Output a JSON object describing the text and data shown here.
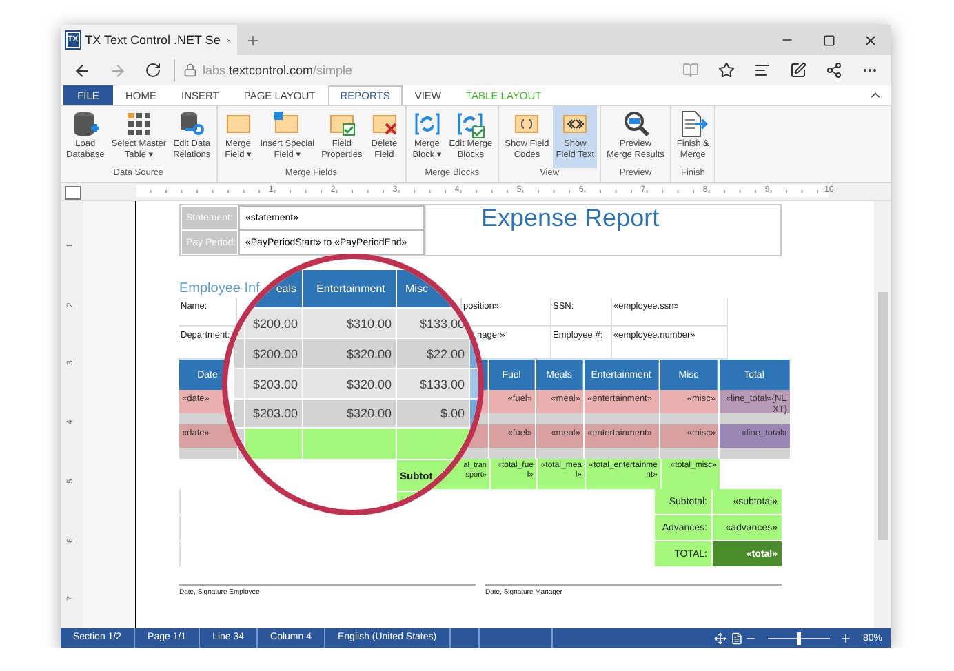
{
  "browser": {
    "tab_icon": "TX",
    "tab_title": "TX Text Control .NET Se",
    "url": {
      "prefix": "labs.",
      "domain": "textcontrol.com",
      "path": "/simple"
    }
  },
  "ribbon": {
    "tabs": [
      {
        "label": "FILE",
        "kind": "file",
        "selected": false
      },
      {
        "label": "HOME",
        "kind": "plain",
        "selected": false
      },
      {
        "label": "INSERT",
        "kind": "plain",
        "selected": false
      },
      {
        "label": "PAGE LAYOUT",
        "kind": "plain",
        "selected": false
      },
      {
        "label": "REPORTS",
        "kind": "plain",
        "selected": true
      },
      {
        "label": "VIEW",
        "kind": "plain",
        "selected": false
      },
      {
        "label": "TABLE LAYOUT",
        "kind": "contextual",
        "selected": false
      }
    ],
    "groups": [
      {
        "title": "Data Source",
        "buttons": [
          {
            "label": "Load\nDatabase",
            "kind": "database",
            "selected": false
          },
          {
            "label": "Select Master\nTable ▾",
            "kind": "grid",
            "selected": false
          },
          {
            "label": "Edit Data\nRelations",
            "kind": "relations",
            "selected": false
          }
        ]
      },
      {
        "title": "Merge Fields",
        "buttons": [
          {
            "label": "Merge\nField ▾",
            "kind": "field",
            "selected": false
          },
          {
            "label": "Insert Special\nField ▾",
            "kind": "special",
            "selected": false
          },
          {
            "label": "Field\nProperties",
            "kind": "properties",
            "selected": false
          },
          {
            "label": "Delete\nField",
            "kind": "delete",
            "selected": false
          }
        ]
      },
      {
        "title": "Merge Blocks",
        "buttons": [
          {
            "label": "Merge\nBlock ▾",
            "kind": "block",
            "selected": false
          },
          {
            "label": "Edit Merge\nBlocks",
            "kind": "editblock",
            "selected": false
          }
        ]
      },
      {
        "title": "View",
        "buttons": [
          {
            "label": "Show Field\nCodes",
            "kind": "codes",
            "selected": false
          },
          {
            "label": "Show\nField Text",
            "kind": "text",
            "selected": true
          }
        ]
      },
      {
        "title": "Preview",
        "buttons": [
          {
            "label": "Preview\nMerge Results",
            "kind": "preview",
            "selected": false
          }
        ]
      },
      {
        "title": "Finish",
        "buttons": [
          {
            "label": "Finish &\nMerge",
            "kind": "finish",
            "selected": false
          }
        ]
      }
    ]
  },
  "rulers": {
    "horizontal": [
      "1",
      "2",
      "3",
      "4",
      "5",
      "6",
      "7",
      "8",
      "9",
      "10"
    ],
    "vertical": [
      "1",
      "2",
      "3",
      "4",
      "5",
      "6",
      "7"
    ]
  },
  "document": {
    "header": {
      "rows": [
        {
          "label": "Statement:",
          "value": "«statement»"
        },
        {
          "label": "Pay Period:",
          "value": "«PayPeriodStart» to «PayPeriodEnd»"
        }
      ],
      "title": "Expense Report"
    },
    "info_heading": "Employee Inf",
    "info_rows": [
      {
        "label": "Name:",
        "value": "position»",
        "label_2": "SSN:",
        "value_2": "«employee.ssn»"
      },
      {
        "label": "Department:",
        "value": "nager»",
        "label_2": "Employee #:",
        "value_2": "«employee.number»"
      }
    ],
    "expense_columns": [
      "Date",
      "Fuel",
      "Meals",
      "Entertainment",
      "Misc",
      "Total"
    ],
    "expense_rows": [
      {
        "date": "«date»",
        "cells": [
          "«fuel»",
          "«meal»",
          "«entertainment»",
          "«misc»",
          "«line_total»{NEXT}"
        ]
      },
      {
        "date": "«date»",
        "cells": [
          "«fuel»",
          "«meal»",
          "«entertainment»",
          "«misc»",
          "«line_total»"
        ]
      }
    ],
    "totals": {
      "partial": "al_transport»",
      "cells": [
        "«total_fuel»",
        "«total_meal»",
        "«total_entertainment»",
        "«total_misc»"
      ]
    },
    "summary": [
      {
        "label": "Subtotal:",
        "value": "«subtotal»",
        "kind": "normal"
      },
      {
        "label": "Advances:",
        "value": "«advances»",
        "kind": "normal"
      },
      {
        "label": "TOTAL:",
        "value": "«total»",
        "kind": "grand"
      }
    ],
    "signatures": [
      "Date, Signature Employee",
      "Date, Signature Manager"
    ]
  },
  "magnifier": {
    "columns": [
      "eals",
      "Entertainment",
      "Misc"
    ],
    "rows": [
      [
        "$200.00",
        "$310.00",
        "$133.00"
      ],
      [
        "$200.00",
        "$320.00",
        "$22.00"
      ],
      [
        "$203.00",
        "$320.00",
        "$133.00"
      ],
      [
        "$203.00",
        "$320.00",
        "$.00"
      ]
    ],
    "subtotal_label": "Subtot"
  },
  "status_bar": {
    "items": [
      "Section 1/2",
      "Page 1/1",
      "Line 34",
      "Column 4",
      "English (United States)"
    ],
    "zoom": {
      "level": 0.5,
      "reading": "80%"
    }
  }
}
